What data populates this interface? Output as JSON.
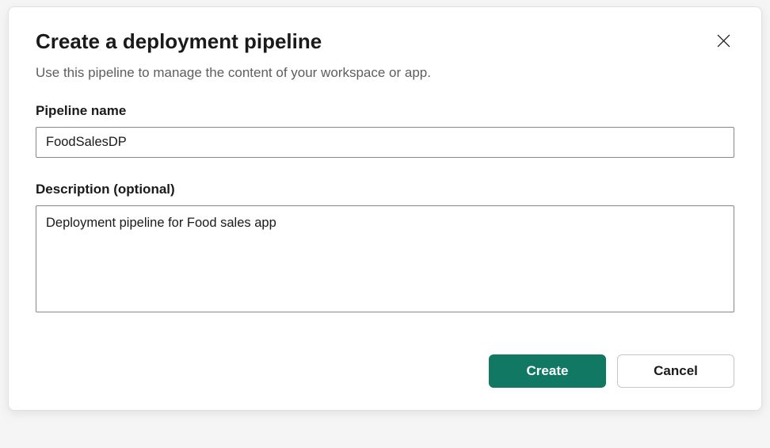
{
  "dialog": {
    "title": "Create a deployment pipeline",
    "subtitle": "Use this pipeline to manage the content of your workspace or app.",
    "fields": {
      "name": {
        "label": "Pipeline name",
        "value": "FoodSalesDP"
      },
      "description": {
        "label": "Description (optional)",
        "value": "Deployment pipeline for Food sales app"
      }
    },
    "buttons": {
      "primary": "Create",
      "secondary": "Cancel"
    }
  },
  "colors": {
    "primary": "#117864"
  }
}
